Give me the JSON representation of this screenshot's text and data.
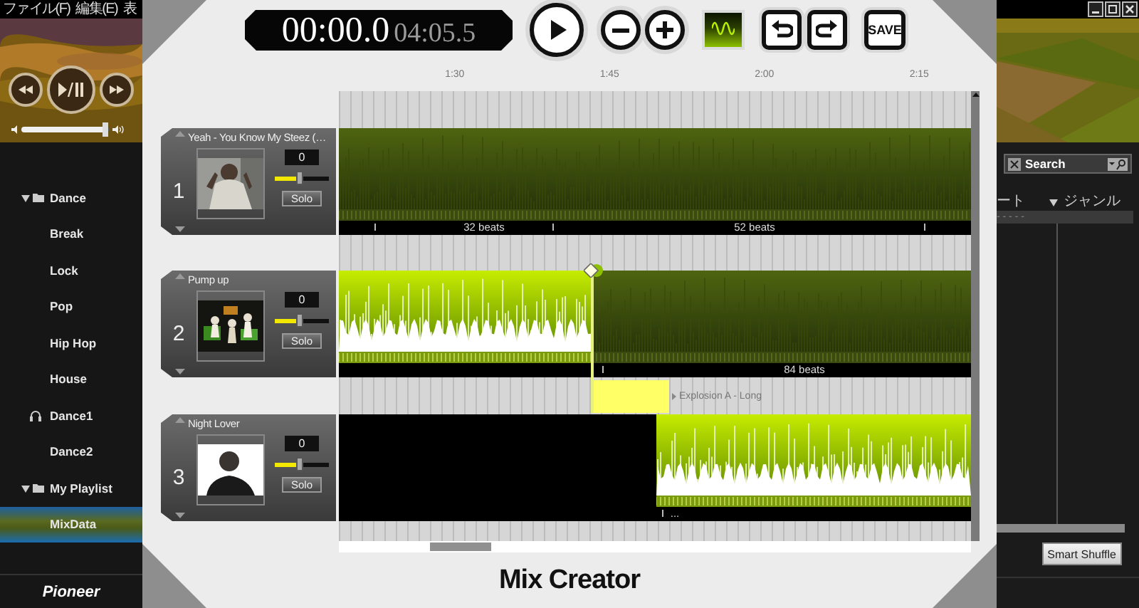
{
  "app_menu": [
    "ファイル(F)",
    "編集(E)",
    "表"
  ],
  "player": {
    "volume": {
      "level": 0.95
    }
  },
  "library_tree": [
    {
      "label": "Dance",
      "kind": "folder",
      "expanded": true,
      "selected": false,
      "children": [
        {
          "label": "Break",
          "kind": "item",
          "selected": false
        },
        {
          "label": "Lock",
          "kind": "item",
          "selected": false
        },
        {
          "label": "Pop",
          "kind": "item",
          "selected": false
        },
        {
          "label": "Hip Hop",
          "kind": "item",
          "selected": false
        },
        {
          "label": "House",
          "kind": "item",
          "selected": false
        },
        {
          "label": "Dance1",
          "kind": "playlist",
          "selected": false
        },
        {
          "label": "Dance2",
          "kind": "item",
          "selected": false
        }
      ]
    },
    {
      "label": "My Playlist",
      "kind": "folder",
      "expanded": true,
      "selected": false,
      "children": [
        {
          "label": "MixData",
          "kind": "item",
          "selected": true
        }
      ]
    }
  ],
  "brand": "Pioneer",
  "mix_creator": {
    "elapsed": "00:00.0",
    "total": "04:05.5",
    "toolbar": [
      {
        "kind": "play"
      },
      {
        "kind": "minus"
      },
      {
        "kind": "plus"
      },
      {
        "kind": "wave"
      },
      {
        "kind": "undo"
      },
      {
        "kind": "redo"
      },
      {
        "kind": "save",
        "label": "SAVE"
      }
    ],
    "ruler": [
      "1:30",
      "1:45",
      "2:00",
      "2:15"
    ],
    "tracks": [
      {
        "number": "1",
        "title": "Yeah - You Know My Steez (…",
        "volume": "0",
        "level": 0.45,
        "solo": "Solo",
        "beats": [
          "32 beats",
          "52 beats"
        ]
      },
      {
        "number": "2",
        "title": "Pump up",
        "volume": "0",
        "level": 0.45,
        "solo": "Solo",
        "beats": [
          "84 beats"
        ]
      },
      {
        "number": "3",
        "title": "Night Lover",
        "volume": "0",
        "level": 0.45,
        "solo": "Solo",
        "beats": [
          "..."
        ]
      }
    ],
    "effect": {
      "label": "Explosion A - Long"
    },
    "title": "Mix Creator"
  },
  "library": {
    "search": {
      "value": "Search"
    },
    "columns": [
      "ート",
      "ジャンル"
    ],
    "rows": [
      [
        "- - - - -"
      ]
    ],
    "smart_shuffle": "Smart Shuffle"
  }
}
